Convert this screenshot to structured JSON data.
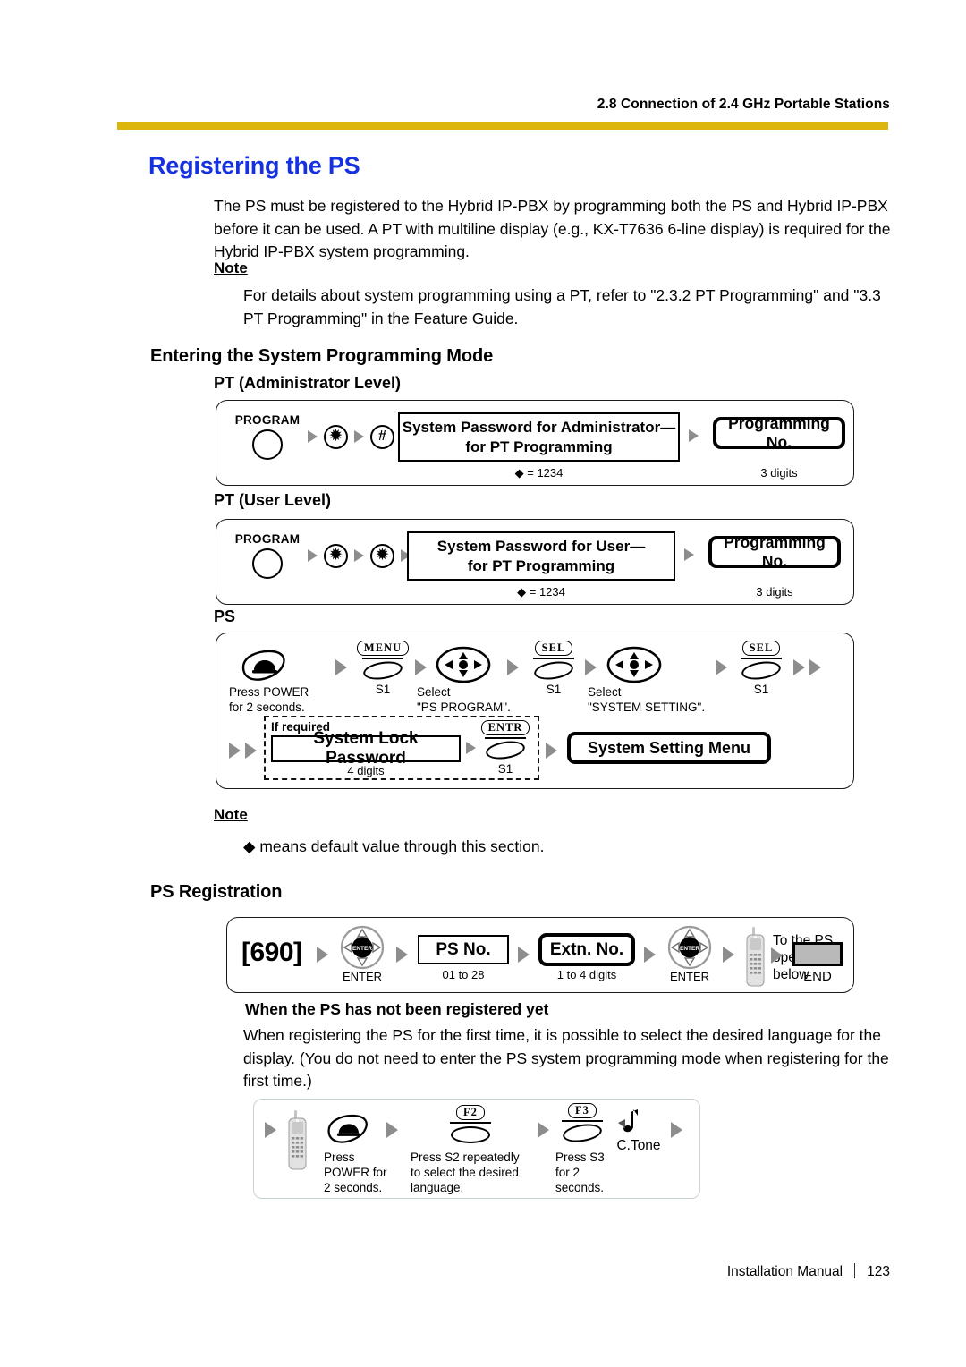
{
  "header": {
    "running_head": "2.8 Connection of 2.4 GHz Portable Stations",
    "rule_color": "#dcb60d"
  },
  "title": {
    "text": "Registering the PS",
    "color": "#1531e0"
  },
  "intro": {
    "paragraph": "The PS must be registered to the Hybrid IP-PBX by programming both the PS and Hybrid IP-PBX before it can be used. A PT with multiline display (e.g., KX-T7636 6-line display) is required for the Hybrid IP-PBX system programming."
  },
  "note1": {
    "label": "Note",
    "text": "For details about system programming using a PT, refer to \"2.3.2 PT Programming\" and \"3.3 PT Programming\" in the Feature Guide."
  },
  "section_entering": {
    "heading": "Entering the System Programming Mode",
    "pt_admin": {
      "subheading": "PT (Administrator Level)",
      "program_key_label": "PROGRAM",
      "key1": "✹",
      "key2": "#",
      "password_box_line1": "System Password for Administrator—",
      "password_box_line2": "for PT Programming",
      "password_default": "◆ = 1234",
      "result_box": "Programming No.",
      "result_caption": "3 digits"
    },
    "pt_user": {
      "subheading": "PT (User Level)",
      "program_key_label": "PROGRAM",
      "key1": "✹",
      "key2": "✹",
      "password_box_line1": "System Password for User—",
      "password_box_line2": "for PT Programming",
      "password_default": "◆ = 1234",
      "result_box": "Programming No.",
      "result_caption": "3 digits"
    },
    "ps": {
      "subheading": "PS",
      "step1_caption_line1": "Press POWER",
      "step1_caption_line2": "for 2 seconds.",
      "step2_key": "MENU",
      "step2_caption": "S1",
      "step3_caption_line1": "Select",
      "step3_caption_line2": "\"PS PROGRAM\".",
      "step4_key": "SEL",
      "step4_caption": "S1",
      "step5_caption_line1": "Select",
      "step5_caption_line2": "\"SYSTEM SETTING\".",
      "step6_key": "SEL",
      "step6_caption": "S1",
      "if_required_label": "If required",
      "lock_box": "System Lock Password",
      "lock_caption": "4 digits",
      "entr_key": "ENTR",
      "entr_caption": "S1",
      "result_box": "System Setting Menu"
    }
  },
  "note2": {
    "label": "Note",
    "text": "◆ means default value through this section."
  },
  "section_registration": {
    "heading": "PS Registration",
    "flow": {
      "code": "[690]",
      "enter1_label": "ENTER",
      "ps_no_box": "PS No.",
      "ps_no_caption": "01 to 28",
      "extn_no_box": "Extn. No.",
      "extn_no_caption": "1 to 4 digits",
      "enter2_label": "ENTER",
      "to_ps_line1": "To the PS",
      "to_ps_line2": "operation",
      "to_ps_line3": "below",
      "end_label": "END"
    },
    "subheading": "When the PS has not been registered yet",
    "paragraph": "When registering the PS for the first time, it is possible to select the desired language for the display. (You do not need to enter the PS system programming mode when registering for the first time.)",
    "lang_flow": {
      "step1_line1": "Press",
      "step1_line2": "POWER for",
      "step1_line3": "2 seconds.",
      "step2_key": "F2",
      "step2_line1": "Press S2 repeatedly",
      "step2_line2": "to select the desired",
      "step2_line3": "language.",
      "step3_key": "F3",
      "step3_line1": "Press S3",
      "step3_line2": "for 2",
      "step3_line3": "seconds.",
      "tone_label": "C.Tone"
    }
  },
  "footer": {
    "manual": "Installation Manual",
    "page": "123"
  }
}
